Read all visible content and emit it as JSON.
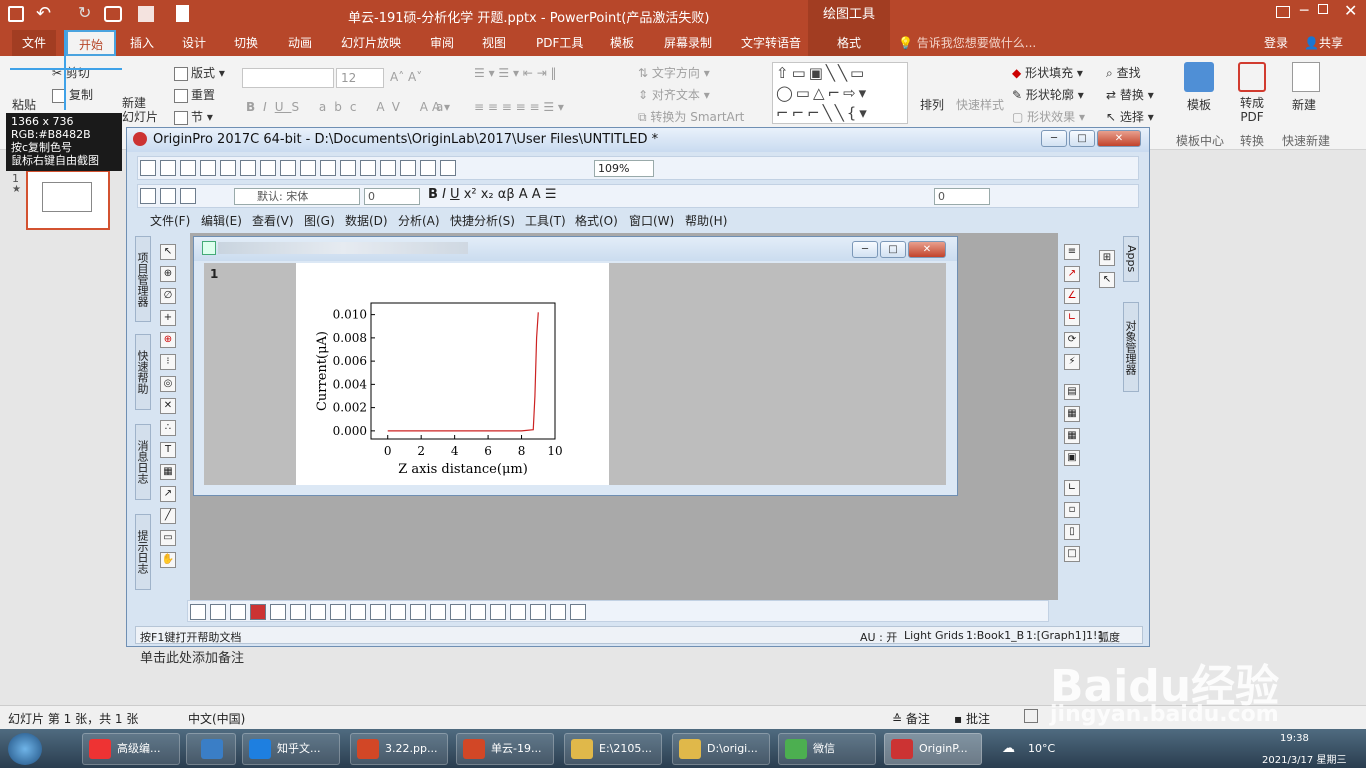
{
  "ppt": {
    "title": "单云-191硕-分析化学 开题.pptx - PowerPoint(产品激活失败)",
    "context_tab": "绘图工具",
    "tabs": [
      "文件",
      "开始",
      "插入",
      "设计",
      "切换",
      "动画",
      "幻灯片放映",
      "审阅",
      "视图",
      "PDF工具",
      "模板",
      "屏幕录制",
      "文字转语音",
      "格式"
    ],
    "search_hint": "告诉我您想要做什么...",
    "login": "登录",
    "share": "共享",
    "ribbon": {
      "paste": "粘贴",
      "cut": "剪切",
      "copy": "复制",
      "new_slide": "新建\n幻灯片",
      "layout": "版式",
      "reset": "重置",
      "section": "节",
      "font_size": "12",
      "text_direction": "文字方向",
      "align_text": "对齐文本",
      "convert_smartart": "转换为 SmartArt",
      "arrange": "排列",
      "quick_styles": "快速样式",
      "shape_fill": "形状填充",
      "shape_outline": "形状轮廓",
      "shape_effects": "形状效果",
      "find": "查找",
      "replace": "替换",
      "select": "选择",
      "template": "模板",
      "to_pdf": "转成\nPDF",
      "new": "新建",
      "group_template": "模板中心",
      "group_convert": "转换",
      "group_new": "快速新建"
    },
    "notes_placeholder": "单击此处添加备注",
    "status": {
      "slide": "幻灯片 第 1 张，共 1 张",
      "lang": "中文(中国)",
      "notes": "备注",
      "comments": "批注"
    }
  },
  "tooltip": {
    "size": "1366 x 736",
    "rgb": "RGB:#B8482B",
    "copy_hint": "按c复制色号",
    "right_hint": "鼠标右键自由截图"
  },
  "origin": {
    "title": "OriginPro 2017C 64-bit - D:\\Documents\\OriginLab\\2017\\User Files\\UNTITLED *",
    "zoom": "109%",
    "font": "默认: 宋体",
    "font_size": "0",
    "line_width": "0",
    "menus": [
      "文件(F)",
      "编辑(E)",
      "查看(V)",
      "图(G)",
      "数据(D)",
      "分析(A)",
      "快捷分析(S)",
      "工具(T)",
      "格式(O)",
      "窗口(W)",
      "帮助(H)"
    ],
    "left_tabs": [
      "项目管理器",
      "快速帮助",
      "消息日志",
      "提示日志"
    ],
    "right_tabs": [
      "Apps",
      "对象管理器"
    ],
    "layer_label": "1",
    "status": {
      "hint": "按F1键打开帮助文档",
      "au": "AU : 开",
      "grids": "Light Grids",
      "book": "1:Book1_B",
      "graph": "1:[Graph1]1!1",
      "unit": "弧度"
    }
  },
  "chart_data": {
    "type": "line",
    "xlabel": "Z axis distance(μm)",
    "ylabel": "Current(μA)",
    "xlim": [
      -1,
      10
    ],
    "ylim": [
      -0.0007,
      0.011
    ],
    "x_ticks": [
      "0",
      "2",
      "4",
      "6",
      "8",
      "10"
    ],
    "y_ticks": [
      "0.000",
      "0.002",
      "0.004",
      "0.006",
      "0.008",
      "0.010"
    ],
    "series": [
      {
        "color": "#cc2222",
        "x": [
          0,
          1,
          2,
          3,
          4,
          5,
          6,
          7,
          8,
          8.7,
          8.8,
          8.9,
          9.0
        ],
        "y": [
          0,
          0,
          0,
          0,
          0,
          0,
          0,
          0,
          0,
          0.0001,
          0.003,
          0.008,
          0.0102
        ]
      }
    ]
  },
  "taskbar": {
    "items": [
      "高级编...",
      "",
      "知乎文...",
      "3.22.pp...",
      "单云-19...",
      "E:\\2105...",
      "D:\\origi...",
      "微信",
      "OriginP..."
    ],
    "weather": "10°C",
    "time": "19:38",
    "date": "2021/3/17 星期三"
  },
  "watermark": {
    "brand": "Baidu经验",
    "url": "jingyan.baidu.com"
  }
}
